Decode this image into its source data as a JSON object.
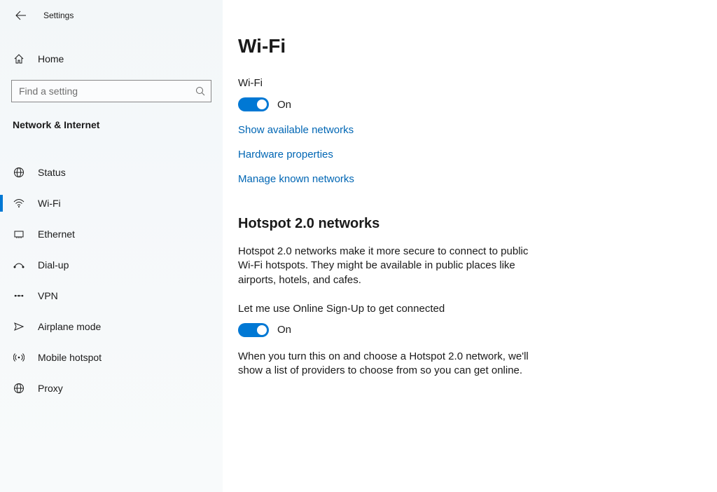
{
  "header": {
    "app_title": "Settings"
  },
  "sidebar": {
    "home_label": "Home",
    "search_placeholder": "Find a setting",
    "section_label": "Network & Internet",
    "items": [
      {
        "label": "Status"
      },
      {
        "label": "Wi-Fi"
      },
      {
        "label": "Ethernet"
      },
      {
        "label": "Dial-up"
      },
      {
        "label": "VPN"
      },
      {
        "label": "Airplane mode"
      },
      {
        "label": "Mobile hotspot"
      },
      {
        "label": "Proxy"
      }
    ]
  },
  "main": {
    "title": "Wi-Fi",
    "wifi": {
      "label": "Wi-Fi",
      "state": "On"
    },
    "links": {
      "show_networks": "Show available networks",
      "hardware_props": "Hardware properties",
      "manage_known": "Manage known networks"
    },
    "hotspot": {
      "title": "Hotspot 2.0 networks",
      "description": "Hotspot 2.0 networks make it more secure to connect to public Wi-Fi hotspots. They might be available in public places like airports, hotels, and cafes.",
      "signup_label": "Let me use Online Sign-Up to get connected",
      "signup_state": "On",
      "signup_note": "When you turn this on and choose a Hotspot 2.0 network, we'll show a list of providers to choose from so you can get online."
    }
  }
}
